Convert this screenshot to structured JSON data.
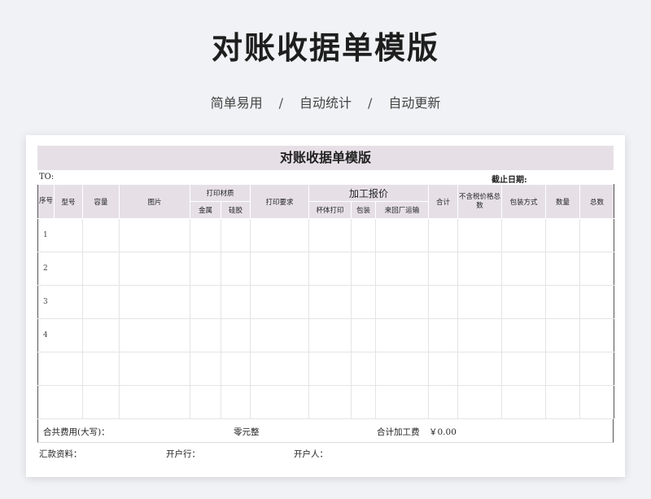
{
  "hero": {
    "title": "对账收据单模版",
    "features": [
      "简单易用",
      "自动统计",
      "自动更新"
    ],
    "separator": "/"
  },
  "document": {
    "title": "对账收据单模版",
    "to_label": "TO:",
    "date_label": "截止日期:",
    "headers": {
      "seq": "序号",
      "model": "型号",
      "capacity": "容量",
      "image": "图片",
      "print_material": "打印材质",
      "metal": "金属",
      "silicone": "硅胶",
      "print_req": "打印要求",
      "processing_quote": "加工报价",
      "cup_print": "杯体打印",
      "packaging": "包装",
      "return_shipping": "来回厂运输",
      "subtotal": "合计",
      "pretax_total": "不含税价格总数",
      "pack_method": "包装方式",
      "quantity": "数量",
      "total": "总数"
    },
    "rows": [
      "1",
      "2",
      "3",
      "4",
      "",
      ""
    ],
    "total_label": "合共费用(大写)：",
    "total_amount_words": "零元整",
    "processing_total_label": "合计加工费",
    "processing_total_value": "￥0.00",
    "bank_info_label": "汇款资料：",
    "bank_name_label": "开户行：",
    "account_holder_label": "开户人："
  }
}
